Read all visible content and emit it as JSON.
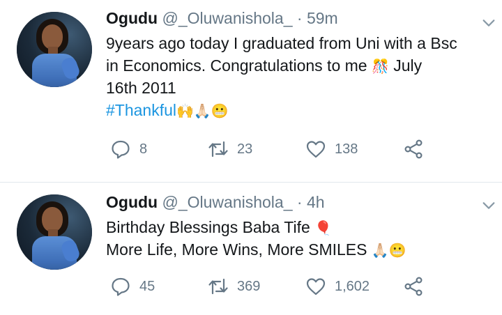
{
  "tweets": [
    {
      "name": "Ogudu",
      "handle": "@_Oluwanishola_",
      "separator": "·",
      "time": "59m",
      "lines": [
        {
          "text": "9years ago today I graduated from Uni with a Bsc"
        },
        {
          "text": "in Economics. Congratulations to me",
          "emoji": "🎊",
          "after": " July"
        },
        {
          "text": "16th 2011"
        }
      ],
      "hashtag": "#Thankful",
      "hashtag_emojis": "🙌🙏🏻😬",
      "actions": {
        "replies": "8",
        "retweets": "23",
        "likes": "138"
      }
    },
    {
      "name": "Ogudu",
      "handle": "@_Oluwanishola_",
      "separator": "·",
      "time": "4h",
      "lines": [
        {
          "text": "Birthday Blessings Baba Tife",
          "emoji": "🎈"
        },
        {
          "text": "More Life, More Wins, More SMILES",
          "emoji": "🙏🏻😬"
        }
      ],
      "actions": {
        "replies": "45",
        "retweets": "369",
        "likes": "1,602"
      }
    }
  ],
  "icons": {
    "reply": "reply-icon",
    "retweet": "retweet-icon",
    "like": "heart-icon",
    "share": "share-icon",
    "menu": "chevron-down-icon"
  },
  "colors": {
    "text": "#14171a",
    "secondary": "#657786",
    "link": "#1b95e0",
    "divider": "#e1e8ed"
  }
}
